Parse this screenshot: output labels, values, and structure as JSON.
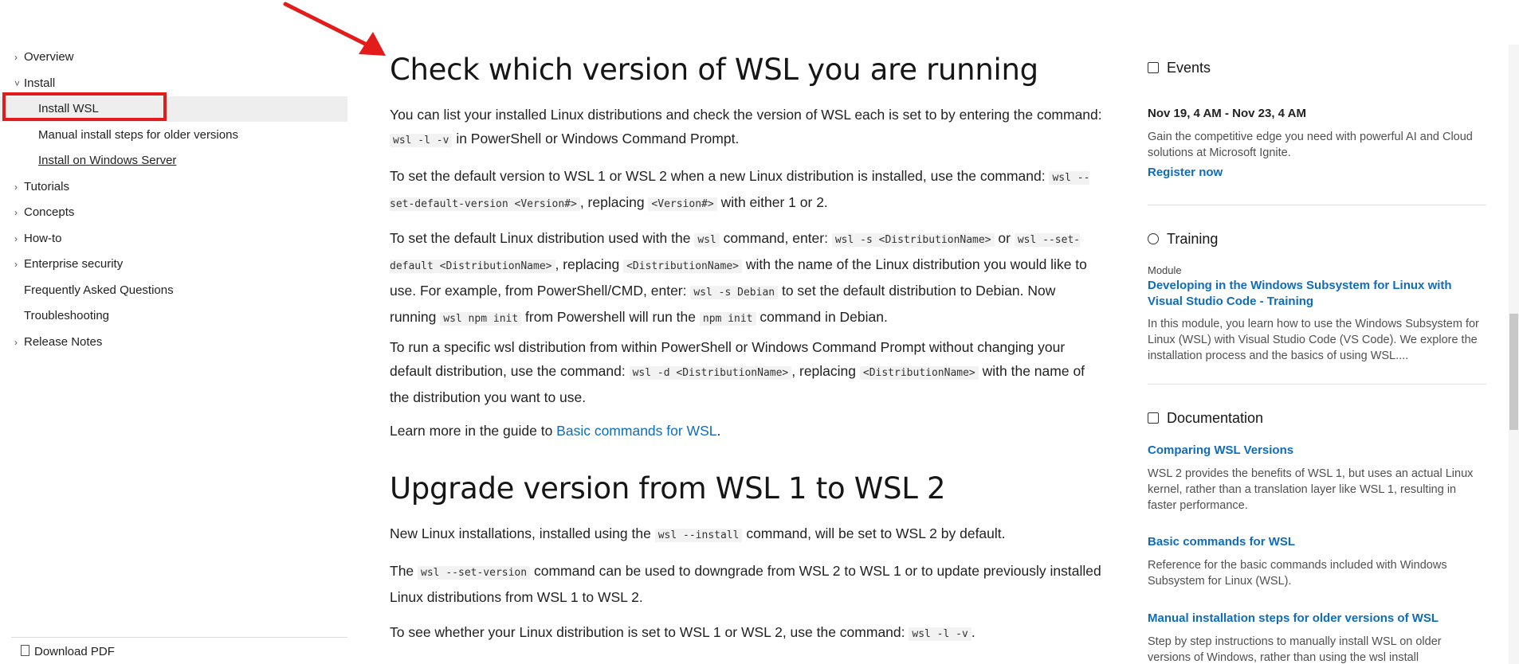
{
  "nav": {
    "items": [
      {
        "label": "Overview",
        "chevron": "›"
      },
      {
        "label": "Install",
        "chevron": "˅"
      },
      {
        "label": "Tutorials",
        "chevron": "›"
      },
      {
        "label": "Concepts",
        "chevron": "›"
      },
      {
        "label": "How-to",
        "chevron": "›"
      },
      {
        "label": "Enterprise security",
        "chevron": "›"
      },
      {
        "label": "Frequently Asked Questions",
        "chevron": ""
      },
      {
        "label": "Troubleshooting",
        "chevron": ""
      },
      {
        "label": "Release Notes",
        "chevron": "›"
      }
    ],
    "sub": [
      "Install WSL",
      "Manual install steps for older versions",
      "Install on Windows Server"
    ],
    "download": "Download PDF"
  },
  "main": {
    "h1a": "Check which version of WSL you are running",
    "p1": [
      "You can list your installed Linux distributions and check the version of WSL each is set to by entering the command: ",
      "wsl -l -v",
      " in PowerShell or Windows Command Prompt."
    ],
    "p2": [
      "To set the default version to WSL 1 or WSL 2 when a new Linux distribution is installed, use the command: ",
      "wsl --set-default-version <Version#>",
      ", replacing ",
      "<Version#>",
      " with either 1 or 2."
    ],
    "p3": [
      "To set the default Linux distribution used with the ",
      "wsl",
      " command, enter: ",
      "wsl -s <DistributionName>",
      " or ",
      "wsl --set-default <DistributionName>",
      ", replacing ",
      "<DistributionName>",
      " with the name of the Linux distribution you would like to use. For example, from PowerShell/CMD, enter: ",
      "wsl -s Debian",
      " to set the default distribution to Debian. Now running ",
      "wsl npm init",
      " from Powershell will run the ",
      "npm init",
      " command in Debian."
    ],
    "p4": [
      "To run a specific wsl distribution from within PowerShell or Windows Command Prompt without changing your default distribution, use the command: ",
      "wsl -d <DistributionName>",
      ", replacing ",
      "<DistributionName>",
      " with the name of the distribution you want to use."
    ],
    "p5": [
      "Learn more in the guide to ",
      "Basic commands for WSL",
      "."
    ],
    "h1b": "Upgrade version from WSL 1 to WSL 2",
    "p6": [
      "New Linux installations, installed using the ",
      "wsl --install",
      " command, will be set to WSL 2 by default."
    ],
    "p7": [
      "The ",
      "wsl --set-version",
      " command can be used to downgrade from WSL 2 to WSL 1 or to update previously installed Linux distributions from WSL 1 to WSL 2."
    ],
    "p8": [
      "To see whether your Linux distribution is set to WSL 1 or WSL 2, use the command: ",
      "wsl -l -v",
      "."
    ]
  },
  "rail": {
    "events": {
      "title": "Events",
      "date": "Nov 19, 4 AM - Nov 23, 4 AM",
      "desc": "Gain the competitive edge you need with powerful AI and Cloud solutions at Microsoft Ignite.",
      "link": "Register now"
    },
    "training": {
      "title": "Training",
      "kind": "Module",
      "link": "Developing in the Windows Subsystem for Linux with Visual Studio Code - Training",
      "desc": "In this module, you learn how to use the Windows Subsystem for Linux (WSL) with Visual Studio Code (VS Code). We explore the installation process and the basics of using WSL...."
    },
    "docs": {
      "title": "Documentation",
      "items": [
        {
          "link": "Comparing WSL Versions",
          "desc": "WSL 2 provides the benefits of WSL 1, but uses an actual Linux kernel, rather than a translation layer like WSL 1, resulting in faster performance."
        },
        {
          "link": "Basic commands for WSL",
          "desc": "Reference for the basic commands included with Windows Subsystem for Linux (WSL)."
        },
        {
          "link": "Manual installation steps for older versions of WSL",
          "desc": "Step by step instructions to manually install WSL on older versions of Windows, rather than using the wsl install"
        }
      ]
    }
  }
}
